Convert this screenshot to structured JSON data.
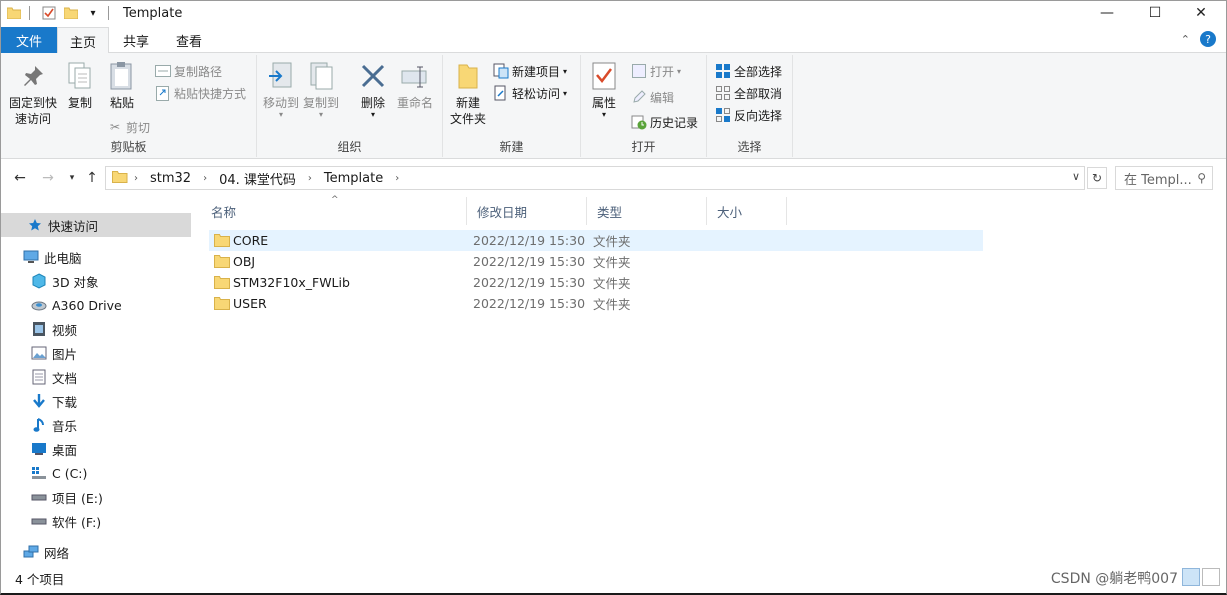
{
  "window": {
    "title": "Template",
    "minimize": "—",
    "maximize": "☐",
    "close": "✕"
  },
  "tabs": {
    "file": "文件",
    "home": "主页",
    "share": "共享",
    "view": "查看"
  },
  "ribbon": {
    "clipboard": {
      "label": "剪贴板",
      "pin_line1": "固定到快",
      "pin_line2": "速访问",
      "copy": "复制",
      "paste": "粘贴",
      "copy_path": "复制路径",
      "paste_shortcut": "粘贴快捷方式",
      "cut": "剪切"
    },
    "organize": {
      "label": "组织",
      "move_to": "移动到",
      "copy_to": "复制到",
      "delete": "删除",
      "rename": "重命名"
    },
    "new": {
      "label": "新建",
      "new_folder_line1": "新建",
      "new_folder_line2": "文件夹",
      "new_item": "新建项目",
      "easy_access": "轻松访问"
    },
    "open": {
      "label": "打开",
      "properties": "属性",
      "open": "打开",
      "edit": "编辑",
      "history": "历史记录"
    },
    "select": {
      "label": "选择",
      "select_all": "全部选择",
      "select_none": "全部取消",
      "invert": "反向选择"
    }
  },
  "address": {
    "crumbs": [
      "stm32",
      "04. 课堂代码",
      "Template"
    ],
    "search_placeholder": "在 Templ..."
  },
  "nav": {
    "quick_access": "快速访问",
    "this_pc": "此电脑",
    "items": [
      "3D 对象",
      "A360 Drive",
      "视频",
      "图片",
      "文档",
      "下载",
      "音乐",
      "桌面",
      "C (C:)",
      "项目 (E:)",
      "软件 (F:)"
    ],
    "network": "网络"
  },
  "columns": {
    "name": "名称",
    "date": "修改日期",
    "type": "类型",
    "size": "大小"
  },
  "files": [
    {
      "name": "CORE",
      "date": "2022/12/19 15:30",
      "type": "文件夹"
    },
    {
      "name": "OBJ",
      "date": "2022/12/19 15:30",
      "type": "文件夹"
    },
    {
      "name": "STM32F10x_FWLib",
      "date": "2022/12/19 15:30",
      "type": "文件夹"
    },
    {
      "name": "USER",
      "date": "2022/12/19 15:30",
      "type": "文件夹"
    }
  ],
  "status": {
    "count": "4 个项目",
    "watermark": "CSDN @躺老鸭007"
  },
  "colors": {
    "accent": "#1979ca",
    "folder": "#f8d775",
    "hover_row": "#e5f3ff"
  }
}
